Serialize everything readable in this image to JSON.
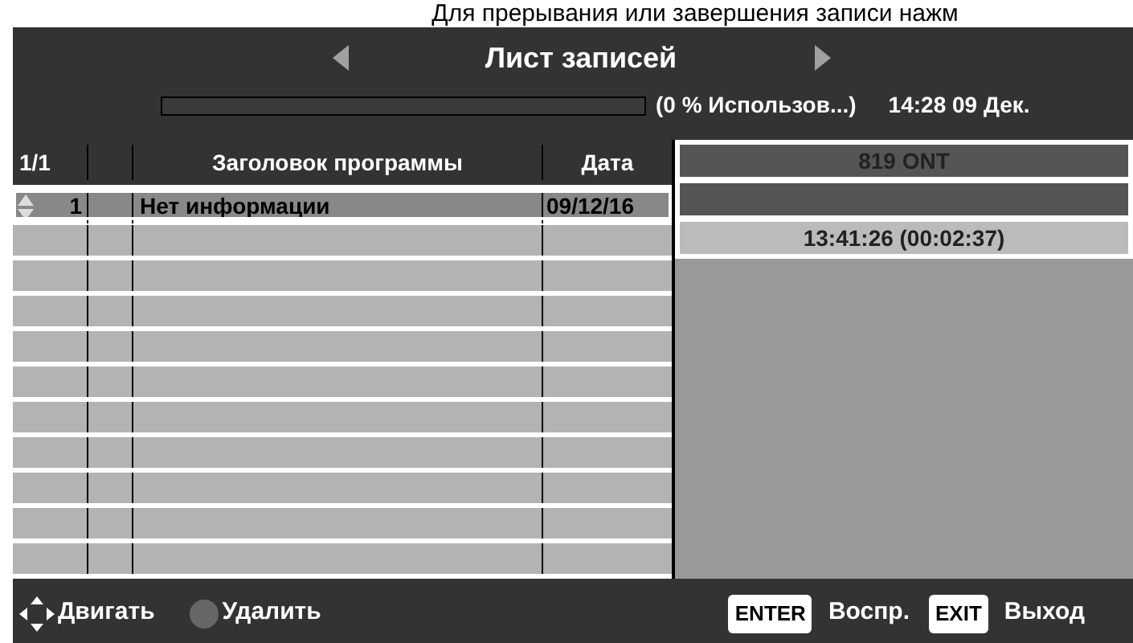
{
  "caption": "Для прерывания или завершения записи нажм",
  "header": {
    "title": "Лист записей",
    "usage": "(0 % Использов...)",
    "clock": "14:28 09 Дек."
  },
  "table": {
    "columns": [
      "1/1",
      "",
      "Заголовок программы",
      "Дата"
    ],
    "rows": [
      {
        "number": "1",
        "title": "Нет информации",
        "date": "09/12/16",
        "selected": true
      }
    ]
  },
  "details": {
    "channel": "819 ONT",
    "time": "13:41:26 (00:02:37)"
  },
  "footer": {
    "left": [
      {
        "kind": "move",
        "label": "Двигать"
      },
      {
        "kind": "dot",
        "label": "Удалить",
        "color": "#666666"
      }
    ],
    "right": [
      {
        "key": "ENTER",
        "label": "Воспр."
      },
      {
        "key": "EXIT",
        "label": "Выход"
      }
    ]
  }
}
